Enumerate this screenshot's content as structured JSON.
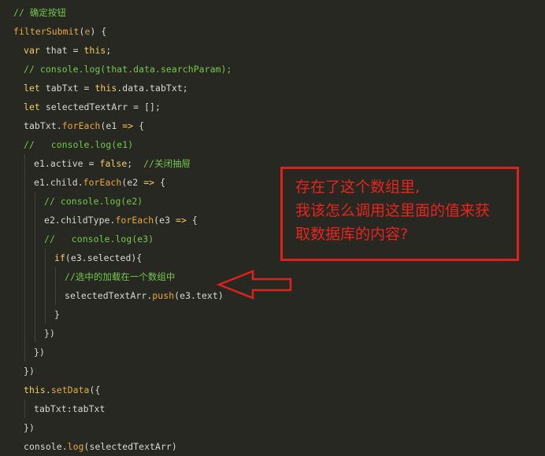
{
  "colors": {
    "background": "#272822",
    "comment": "#75c84a",
    "keyword": "#f7ce5c",
    "function": "#e6a93f",
    "text": "#d9d9cf",
    "param": "#c9a25a",
    "indent_guide": "#414339",
    "annotation_red": "#e0201b"
  },
  "code": {
    "lines": [
      {
        "indent": 1,
        "tokens": [
          {
            "t": "// 确定按钮",
            "c": "comment"
          }
        ]
      },
      {
        "indent": 1,
        "tokens": [
          {
            "t": "filterSubmit",
            "c": "function"
          },
          {
            "t": "(",
            "c": "text"
          },
          {
            "t": "e",
            "c": "param"
          },
          {
            "t": ") {",
            "c": "text"
          }
        ]
      },
      {
        "indent": 2,
        "tokens": [
          {
            "t": "var",
            "c": "keyword"
          },
          {
            "t": " that = ",
            "c": "text"
          },
          {
            "t": "this",
            "c": "keyword"
          },
          {
            "t": ";",
            "c": "text"
          }
        ]
      },
      {
        "indent": 2,
        "tokens": [
          {
            "t": "// console.log(that.data.searchParam);",
            "c": "comment"
          }
        ]
      },
      {
        "indent": 2,
        "tokens": [
          {
            "t": "let",
            "c": "keyword"
          },
          {
            "t": " tabTxt = ",
            "c": "text"
          },
          {
            "t": "this",
            "c": "keyword"
          },
          {
            "t": ".data.tabTxt;",
            "c": "text"
          }
        ]
      },
      {
        "indent": 2,
        "tokens": [
          {
            "t": "let",
            "c": "keyword"
          },
          {
            "t": " selectedTextArr = [];",
            "c": "text"
          }
        ]
      },
      {
        "indent": 2,
        "tokens": [
          {
            "t": "tabTxt.",
            "c": "text"
          },
          {
            "t": "forEach",
            "c": "function"
          },
          {
            "t": "(e1 ",
            "c": "text"
          },
          {
            "t": "=>",
            "c": "keyword"
          },
          {
            "t": " {",
            "c": "text"
          }
        ]
      },
      {
        "indent": 2,
        "tokens": [
          {
            "t": "//   console.log(e1)",
            "c": "comment"
          }
        ]
      },
      {
        "indent": 3,
        "tokens": [
          {
            "t": "e1.active = ",
            "c": "text"
          },
          {
            "t": "false",
            "c": "keyword"
          },
          {
            "t": ";  ",
            "c": "text"
          },
          {
            "t": "//关闭抽屉",
            "c": "comment"
          }
        ]
      },
      {
        "indent": 3,
        "tokens": [
          {
            "t": "e1.child.",
            "c": "text"
          },
          {
            "t": "forEach",
            "c": "function"
          },
          {
            "t": "(e2 ",
            "c": "text"
          },
          {
            "t": "=>",
            "c": "keyword"
          },
          {
            "t": " {",
            "c": "text"
          }
        ]
      },
      {
        "indent": 4,
        "tokens": [
          {
            "t": "// console.log(e2)",
            "c": "comment"
          }
        ]
      },
      {
        "indent": 4,
        "tokens": [
          {
            "t": "e2.childType.",
            "c": "text"
          },
          {
            "t": "forEach",
            "c": "function"
          },
          {
            "t": "(e3 ",
            "c": "text"
          },
          {
            "t": "=>",
            "c": "keyword"
          },
          {
            "t": " {",
            "c": "text"
          }
        ]
      },
      {
        "indent": 4,
        "tokens": [
          {
            "t": "//   console.log(e3)",
            "c": "comment"
          }
        ]
      },
      {
        "indent": 5,
        "tokens": [
          {
            "t": "if",
            "c": "keyword"
          },
          {
            "t": "(e3.selected){",
            "c": "text"
          }
        ]
      },
      {
        "indent": 6,
        "tokens": [
          {
            "t": "//选中的加载在一个数组中",
            "c": "comment"
          }
        ]
      },
      {
        "indent": 6,
        "tokens": [
          {
            "t": "selectedTextArr.",
            "c": "text"
          },
          {
            "t": "push",
            "c": "function"
          },
          {
            "t": "(e3.text)",
            "c": "text"
          }
        ]
      },
      {
        "indent": 5,
        "tokens": [
          {
            "t": "}",
            "c": "text"
          }
        ]
      },
      {
        "indent": 4,
        "tokens": [
          {
            "t": "})",
            "c": "text"
          }
        ]
      },
      {
        "indent": 3,
        "tokens": [
          {
            "t": "})",
            "c": "text"
          }
        ]
      },
      {
        "indent": 2,
        "tokens": [
          {
            "t": "})",
            "c": "text"
          }
        ]
      },
      {
        "indent": 2,
        "tokens": [
          {
            "t": "this",
            "c": "keyword"
          },
          {
            "t": ".",
            "c": "text"
          },
          {
            "t": "setData",
            "c": "function"
          },
          {
            "t": "({",
            "c": "text"
          }
        ]
      },
      {
        "indent": 3,
        "tokens": [
          {
            "t": "tabTxt:tabTxt",
            "c": "text"
          }
        ]
      },
      {
        "indent": 2,
        "tokens": [
          {
            "t": "})",
            "c": "text"
          }
        ]
      },
      {
        "indent": 2,
        "tokens": [
          {
            "t": "console.",
            "c": "text"
          },
          {
            "t": "log",
            "c": "function"
          },
          {
            "t": "(selectedTextArr)",
            "c": "text"
          }
        ]
      }
    ]
  },
  "annotation": {
    "lines": [
      "存在了这个数组里,",
      "我该怎么调用这里面的值来获",
      "取数据库的内容?"
    ]
  }
}
